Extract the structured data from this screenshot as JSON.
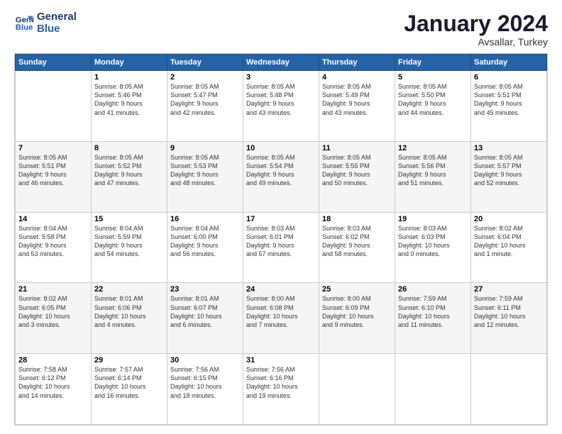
{
  "logo": {
    "line1": "General",
    "line2": "Blue"
  },
  "header": {
    "title": "January 2024",
    "subtitle": "Avsallar, Turkey"
  },
  "weekdays": [
    "Sunday",
    "Monday",
    "Tuesday",
    "Wednesday",
    "Thursday",
    "Friday",
    "Saturday"
  ],
  "weeks": [
    [
      {
        "day": "",
        "info": ""
      },
      {
        "day": "1",
        "info": "Sunrise: 8:05 AM\nSunset: 5:46 PM\nDaylight: 9 hours\nand 41 minutes."
      },
      {
        "day": "2",
        "info": "Sunrise: 8:05 AM\nSunset: 5:47 PM\nDaylight: 9 hours\nand 42 minutes."
      },
      {
        "day": "3",
        "info": "Sunrise: 8:05 AM\nSunset: 5:48 PM\nDaylight: 9 hours\nand 43 minutes."
      },
      {
        "day": "4",
        "info": "Sunrise: 8:05 AM\nSunset: 5:49 PM\nDaylight: 9 hours\nand 43 minutes."
      },
      {
        "day": "5",
        "info": "Sunrise: 8:05 AM\nSunset: 5:50 PM\nDaylight: 9 hours\nand 44 minutes."
      },
      {
        "day": "6",
        "info": "Sunrise: 8:05 AM\nSunset: 5:51 PM\nDaylight: 9 hours\nand 45 minutes."
      }
    ],
    [
      {
        "day": "7",
        "info": "Sunrise: 8:05 AM\nSunset: 5:51 PM\nDaylight: 9 hours\nand 46 minutes."
      },
      {
        "day": "8",
        "info": "Sunrise: 8:05 AM\nSunset: 5:52 PM\nDaylight: 9 hours\nand 47 minutes."
      },
      {
        "day": "9",
        "info": "Sunrise: 8:05 AM\nSunset: 5:53 PM\nDaylight: 9 hours\nand 48 minutes."
      },
      {
        "day": "10",
        "info": "Sunrise: 8:05 AM\nSunset: 5:54 PM\nDaylight: 9 hours\nand 49 minutes."
      },
      {
        "day": "11",
        "info": "Sunrise: 8:05 AM\nSunset: 5:55 PM\nDaylight: 9 hours\nand 50 minutes."
      },
      {
        "day": "12",
        "info": "Sunrise: 8:05 AM\nSunset: 5:56 PM\nDaylight: 9 hours\nand 51 minutes."
      },
      {
        "day": "13",
        "info": "Sunrise: 8:05 AM\nSunset: 5:57 PM\nDaylight: 9 hours\nand 52 minutes."
      }
    ],
    [
      {
        "day": "14",
        "info": "Sunrise: 8:04 AM\nSunset: 5:58 PM\nDaylight: 9 hours\nand 53 minutes."
      },
      {
        "day": "15",
        "info": "Sunrise: 8:04 AM\nSunset: 5:59 PM\nDaylight: 9 hours\nand 54 minutes."
      },
      {
        "day": "16",
        "info": "Sunrise: 8:04 AM\nSunset: 6:00 PM\nDaylight: 9 hours\nand 56 minutes."
      },
      {
        "day": "17",
        "info": "Sunrise: 8:03 AM\nSunset: 6:01 PM\nDaylight: 9 hours\nand 57 minutes."
      },
      {
        "day": "18",
        "info": "Sunrise: 8:03 AM\nSunset: 6:02 PM\nDaylight: 9 hours\nand 58 minutes."
      },
      {
        "day": "19",
        "info": "Sunrise: 8:03 AM\nSunset: 6:03 PM\nDaylight: 10 hours\nand 0 minutes."
      },
      {
        "day": "20",
        "info": "Sunrise: 8:02 AM\nSunset: 6:04 PM\nDaylight: 10 hours\nand 1 minute."
      }
    ],
    [
      {
        "day": "21",
        "info": "Sunrise: 8:02 AM\nSunset: 6:05 PM\nDaylight: 10 hours\nand 3 minutes."
      },
      {
        "day": "22",
        "info": "Sunrise: 8:01 AM\nSunset: 6:06 PM\nDaylight: 10 hours\nand 4 minutes."
      },
      {
        "day": "23",
        "info": "Sunrise: 8:01 AM\nSunset: 6:07 PM\nDaylight: 10 hours\nand 6 minutes."
      },
      {
        "day": "24",
        "info": "Sunrise: 8:00 AM\nSunset: 6:08 PM\nDaylight: 10 hours\nand 7 minutes."
      },
      {
        "day": "25",
        "info": "Sunrise: 8:00 AM\nSunset: 6:09 PM\nDaylight: 10 hours\nand 9 minutes."
      },
      {
        "day": "26",
        "info": "Sunrise: 7:59 AM\nSunset: 6:10 PM\nDaylight: 10 hours\nand 11 minutes."
      },
      {
        "day": "27",
        "info": "Sunrise: 7:59 AM\nSunset: 6:11 PM\nDaylight: 10 hours\nand 12 minutes."
      }
    ],
    [
      {
        "day": "28",
        "info": "Sunrise: 7:58 AM\nSunset: 6:12 PM\nDaylight: 10 hours\nand 14 minutes."
      },
      {
        "day": "29",
        "info": "Sunrise: 7:57 AM\nSunset: 6:14 PM\nDaylight: 10 hours\nand 16 minutes."
      },
      {
        "day": "30",
        "info": "Sunrise: 7:56 AM\nSunset: 6:15 PM\nDaylight: 10 hours\nand 18 minutes."
      },
      {
        "day": "31",
        "info": "Sunrise: 7:56 AM\nSunset: 6:16 PM\nDaylight: 10 hours\nand 19 minutes."
      },
      {
        "day": "",
        "info": ""
      },
      {
        "day": "",
        "info": ""
      },
      {
        "day": "",
        "info": ""
      }
    ]
  ]
}
